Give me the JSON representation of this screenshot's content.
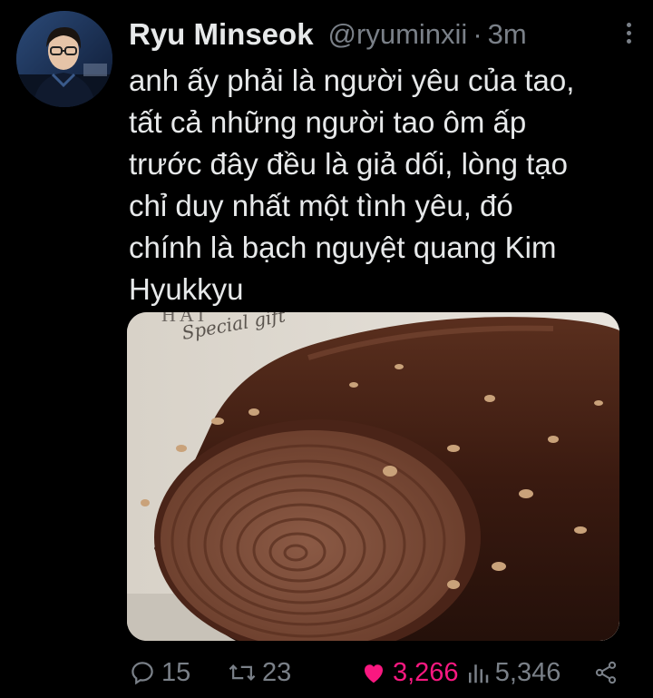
{
  "tweet": {
    "author_name": "Ryu Minseok",
    "author_handle": "@ryuminxii",
    "separator": "·",
    "time": "3m",
    "text": "anh ấy phải là người yêu của tao,\ntất cả những người tao ôm ấp\ntrước đây đều là giả dối, lòng tạo\nchỉ duy nhất một tình yêu, đó\nchính là bạch nguyệt quang Kim\nHyukkyu",
    "media_caption": "Special gift",
    "media_brand": "HAI",
    "stats": {
      "replies": "15",
      "retweets": "23",
      "likes": "3,266",
      "views": "5,346"
    }
  },
  "icons": {
    "reply": "reply-icon",
    "retweet": "retweet-icon",
    "like": "heart-icon",
    "views": "analytics-icon",
    "share": "share-icon",
    "more": "more-icon"
  },
  "colors": {
    "background": "#000000",
    "text": "#e7e9ea",
    "secondary": "#7a8088",
    "like": "#f91880"
  }
}
